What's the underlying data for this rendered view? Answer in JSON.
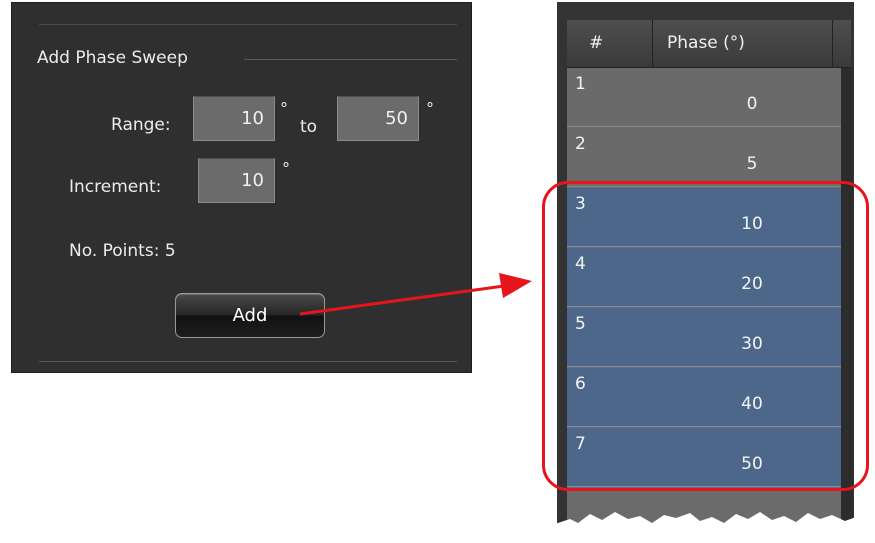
{
  "panel": {
    "title": "Add Phase Sweep",
    "range_label": "Range:",
    "range_from": "10",
    "range_to_label": "to",
    "range_to": "50",
    "degree_symbol": "°",
    "increment_label": "Increment:",
    "increment": "10",
    "points_label": "No. Points: 5",
    "add_label": "Add"
  },
  "table": {
    "columns": [
      "#",
      "Phase (°)"
    ],
    "rows": [
      {
        "num": "1",
        "phase": "0",
        "selected": false
      },
      {
        "num": "2",
        "phase": "5",
        "selected": false
      },
      {
        "num": "3",
        "phase": "10",
        "selected": true
      },
      {
        "num": "4",
        "phase": "20",
        "selected": true
      },
      {
        "num": "5",
        "phase": "30",
        "selected": true
      },
      {
        "num": "6",
        "phase": "40",
        "selected": true
      },
      {
        "num": "7",
        "phase": "50",
        "selected": true
      }
    ]
  },
  "colors": {
    "annotation": "#e8141b",
    "selected_row": "#4d678a",
    "panel_bg": "#2f2f2f"
  }
}
